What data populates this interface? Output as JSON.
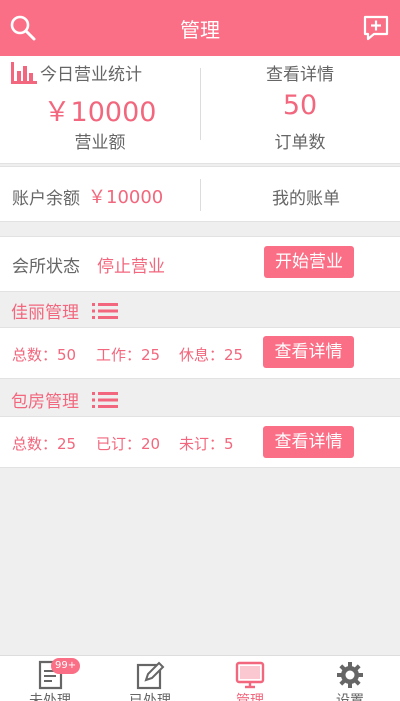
{
  "header": {
    "title": "管理",
    "search_icon": "search-icon",
    "add_icon": "chat-plus-icon"
  },
  "stats": {
    "title": "今日营业统计",
    "detail_link": "查看详情",
    "revenue_value": "￥10000",
    "revenue_label": "营业额",
    "orders_value": "50",
    "orders_label": "订单数"
  },
  "account": {
    "balance_label": "账户余额",
    "balance_value": "￥10000",
    "bill_link": "我的账单"
  },
  "status": {
    "label": "会所状态",
    "value": "停止营业",
    "start_button": "开始营业"
  },
  "sections": [
    {
      "title": "佳丽管理",
      "stats": [
        "总数：50",
        "工作：25",
        "休息：25"
      ],
      "button": "查看详情"
    },
    {
      "title": "包房管理",
      "stats": [
        "总数：25",
        "已订：20",
        "未订：5"
      ],
      "button": "查看详情"
    }
  ],
  "tabs": [
    {
      "label": "未处理",
      "icon": "pending-doc-icon",
      "badge": "99+"
    },
    {
      "label": "已处理",
      "icon": "edit-icon"
    },
    {
      "label": "管理",
      "icon": "monitor-icon",
      "active": true
    },
    {
      "label": "设置",
      "icon": "gear-icon"
    }
  ],
  "colors": {
    "accent": "#fb6f86",
    "accent_text": "#f2677d",
    "background": "#efefef"
  }
}
